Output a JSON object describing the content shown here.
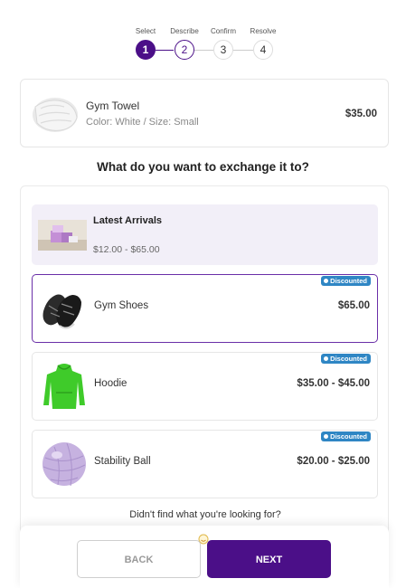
{
  "stepper": {
    "steps": [
      {
        "label": "Select",
        "number": "1"
      },
      {
        "label": "Describe",
        "number": "2"
      },
      {
        "label": "Confirm",
        "number": "3"
      },
      {
        "label": "Resolve",
        "number": "4"
      }
    ]
  },
  "original_item": {
    "name": "Gym Towel",
    "meta": "Color: White / Size: Small",
    "price": "$35.00"
  },
  "question": "What do you want to exchange it to?",
  "latest": {
    "title": "Latest Arrivals",
    "price_range": "$12.00 - $65.00"
  },
  "products": [
    {
      "name": "Gym Shoes",
      "price": "$65.00",
      "badge": "Discounted",
      "selected": true
    },
    {
      "name": "Hoodie",
      "price": "$35.00 - $45.00",
      "badge": "Discounted",
      "selected": false
    },
    {
      "name": "Stability Ball",
      "price": "$20.00 - $25.00",
      "badge": "Discounted",
      "selected": false
    }
  ],
  "not_found_text": "Didn't find what you're looking for?",
  "footer": {
    "back_label": "BACK",
    "next_label": "NEXT"
  },
  "colors": {
    "accent": "#4b0f88",
    "badge": "#2f86c4",
    "latest_bg": "#f2eff8"
  }
}
